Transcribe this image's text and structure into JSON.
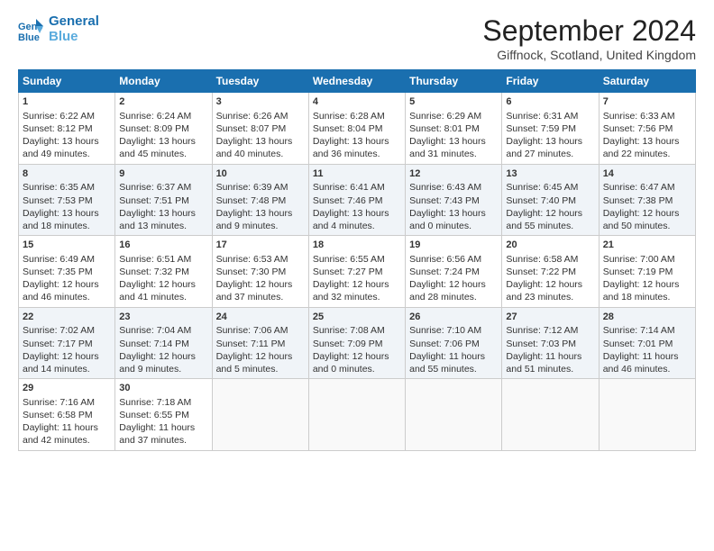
{
  "header": {
    "logo_line1": "General",
    "logo_line2": "Blue",
    "month_title": "September 2024",
    "location": "Giffnock, Scotland, United Kingdom"
  },
  "days_of_week": [
    "Sunday",
    "Monday",
    "Tuesday",
    "Wednesday",
    "Thursday",
    "Friday",
    "Saturday"
  ],
  "weeks": [
    [
      {
        "day": "1",
        "lines": [
          "Sunrise: 6:22 AM",
          "Sunset: 8:12 PM",
          "Daylight: 13 hours",
          "and 49 minutes."
        ]
      },
      {
        "day": "2",
        "lines": [
          "Sunrise: 6:24 AM",
          "Sunset: 8:09 PM",
          "Daylight: 13 hours",
          "and 45 minutes."
        ]
      },
      {
        "day": "3",
        "lines": [
          "Sunrise: 6:26 AM",
          "Sunset: 8:07 PM",
          "Daylight: 13 hours",
          "and 40 minutes."
        ]
      },
      {
        "day": "4",
        "lines": [
          "Sunrise: 6:28 AM",
          "Sunset: 8:04 PM",
          "Daylight: 13 hours",
          "and 36 minutes."
        ]
      },
      {
        "day": "5",
        "lines": [
          "Sunrise: 6:29 AM",
          "Sunset: 8:01 PM",
          "Daylight: 13 hours",
          "and 31 minutes."
        ]
      },
      {
        "day": "6",
        "lines": [
          "Sunrise: 6:31 AM",
          "Sunset: 7:59 PM",
          "Daylight: 13 hours",
          "and 27 minutes."
        ]
      },
      {
        "day": "7",
        "lines": [
          "Sunrise: 6:33 AM",
          "Sunset: 7:56 PM",
          "Daylight: 13 hours",
          "and 22 minutes."
        ]
      }
    ],
    [
      {
        "day": "8",
        "lines": [
          "Sunrise: 6:35 AM",
          "Sunset: 7:53 PM",
          "Daylight: 13 hours",
          "and 18 minutes."
        ]
      },
      {
        "day": "9",
        "lines": [
          "Sunrise: 6:37 AM",
          "Sunset: 7:51 PM",
          "Daylight: 13 hours",
          "and 13 minutes."
        ]
      },
      {
        "day": "10",
        "lines": [
          "Sunrise: 6:39 AM",
          "Sunset: 7:48 PM",
          "Daylight: 13 hours",
          "and 9 minutes."
        ]
      },
      {
        "day": "11",
        "lines": [
          "Sunrise: 6:41 AM",
          "Sunset: 7:46 PM",
          "Daylight: 13 hours",
          "and 4 minutes."
        ]
      },
      {
        "day": "12",
        "lines": [
          "Sunrise: 6:43 AM",
          "Sunset: 7:43 PM",
          "Daylight: 13 hours",
          "and 0 minutes."
        ]
      },
      {
        "day": "13",
        "lines": [
          "Sunrise: 6:45 AM",
          "Sunset: 7:40 PM",
          "Daylight: 12 hours",
          "and 55 minutes."
        ]
      },
      {
        "day": "14",
        "lines": [
          "Sunrise: 6:47 AM",
          "Sunset: 7:38 PM",
          "Daylight: 12 hours",
          "and 50 minutes."
        ]
      }
    ],
    [
      {
        "day": "15",
        "lines": [
          "Sunrise: 6:49 AM",
          "Sunset: 7:35 PM",
          "Daylight: 12 hours",
          "and 46 minutes."
        ]
      },
      {
        "day": "16",
        "lines": [
          "Sunrise: 6:51 AM",
          "Sunset: 7:32 PM",
          "Daylight: 12 hours",
          "and 41 minutes."
        ]
      },
      {
        "day": "17",
        "lines": [
          "Sunrise: 6:53 AM",
          "Sunset: 7:30 PM",
          "Daylight: 12 hours",
          "and 37 minutes."
        ]
      },
      {
        "day": "18",
        "lines": [
          "Sunrise: 6:55 AM",
          "Sunset: 7:27 PM",
          "Daylight: 12 hours",
          "and 32 minutes."
        ]
      },
      {
        "day": "19",
        "lines": [
          "Sunrise: 6:56 AM",
          "Sunset: 7:24 PM",
          "Daylight: 12 hours",
          "and 28 minutes."
        ]
      },
      {
        "day": "20",
        "lines": [
          "Sunrise: 6:58 AM",
          "Sunset: 7:22 PM",
          "Daylight: 12 hours",
          "and 23 minutes."
        ]
      },
      {
        "day": "21",
        "lines": [
          "Sunrise: 7:00 AM",
          "Sunset: 7:19 PM",
          "Daylight: 12 hours",
          "and 18 minutes."
        ]
      }
    ],
    [
      {
        "day": "22",
        "lines": [
          "Sunrise: 7:02 AM",
          "Sunset: 7:17 PM",
          "Daylight: 12 hours",
          "and 14 minutes."
        ]
      },
      {
        "day": "23",
        "lines": [
          "Sunrise: 7:04 AM",
          "Sunset: 7:14 PM",
          "Daylight: 12 hours",
          "and 9 minutes."
        ]
      },
      {
        "day": "24",
        "lines": [
          "Sunrise: 7:06 AM",
          "Sunset: 7:11 PM",
          "Daylight: 12 hours",
          "and 5 minutes."
        ]
      },
      {
        "day": "25",
        "lines": [
          "Sunrise: 7:08 AM",
          "Sunset: 7:09 PM",
          "Daylight: 12 hours",
          "and 0 minutes."
        ]
      },
      {
        "day": "26",
        "lines": [
          "Sunrise: 7:10 AM",
          "Sunset: 7:06 PM",
          "Daylight: 11 hours",
          "and 55 minutes."
        ]
      },
      {
        "day": "27",
        "lines": [
          "Sunrise: 7:12 AM",
          "Sunset: 7:03 PM",
          "Daylight: 11 hours",
          "and 51 minutes."
        ]
      },
      {
        "day": "28",
        "lines": [
          "Sunrise: 7:14 AM",
          "Sunset: 7:01 PM",
          "Daylight: 11 hours",
          "and 46 minutes."
        ]
      }
    ],
    [
      {
        "day": "29",
        "lines": [
          "Sunrise: 7:16 AM",
          "Sunset: 6:58 PM",
          "Daylight: 11 hours",
          "and 42 minutes."
        ]
      },
      {
        "day": "30",
        "lines": [
          "Sunrise: 7:18 AM",
          "Sunset: 6:55 PM",
          "Daylight: 11 hours",
          "and 37 minutes."
        ]
      },
      {
        "day": "",
        "lines": []
      },
      {
        "day": "",
        "lines": []
      },
      {
        "day": "",
        "lines": []
      },
      {
        "day": "",
        "lines": []
      },
      {
        "day": "",
        "lines": []
      }
    ]
  ]
}
